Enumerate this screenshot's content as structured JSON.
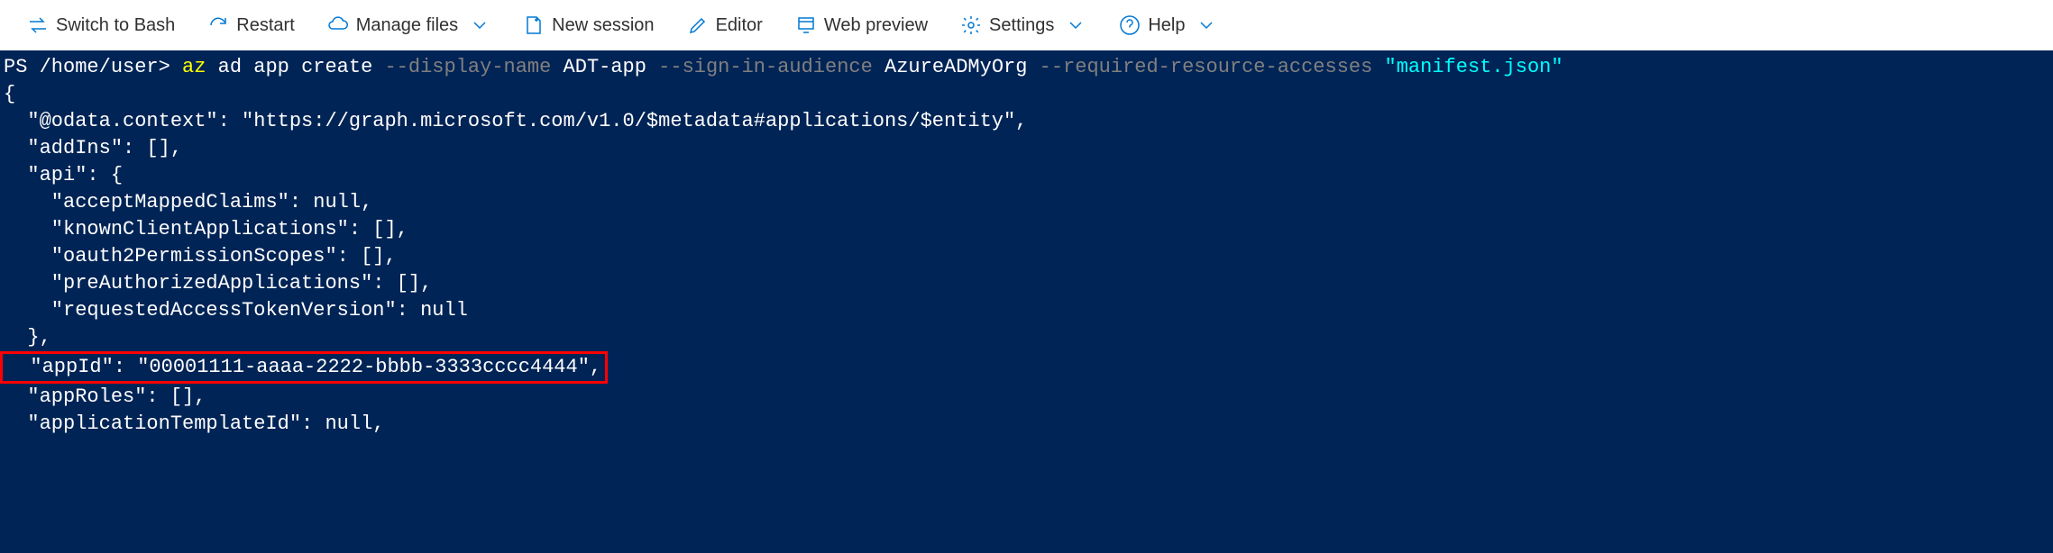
{
  "toolbar": {
    "switch_label": "Switch to Bash",
    "restart_label": "Restart",
    "manage_files_label": "Manage files",
    "new_session_label": "New session",
    "editor_label": "Editor",
    "web_preview_label": "Web preview",
    "settings_label": "Settings",
    "help_label": "Help"
  },
  "terminal": {
    "prompt_prefix": "PS ",
    "prompt_path": "/home/user",
    "prompt_suffix": "> ",
    "cmd_az": "az",
    "cmd_rest": " ad app create ",
    "param_display_name": "--display-name",
    "value_display_name": " ADT-app ",
    "param_signin": "--sign-in-audience",
    "value_signin": " AzureADMyOrg ",
    "param_resources": "--required-resource-accesses",
    "value_manifest": " \"manifest.json\"",
    "output": {
      "line1": "{",
      "line2": "  \"@odata.context\": \"https://graph.microsoft.com/v1.0/$metadata#applications/$entity\",",
      "line3": "  \"addIns\": [],",
      "line4": "  \"api\": {",
      "line5": "    \"acceptMappedClaims\": null,",
      "line6": "    \"knownClientApplications\": [],",
      "line7": "    \"oauth2PermissionScopes\": [],",
      "line8": "    \"preAuthorizedApplications\": [],",
      "line9": "    \"requestedAccessTokenVersion\": null",
      "line10": "  },",
      "line11": "  \"appId\": \"00001111-aaaa-2222-bbbb-3333cccc4444\",",
      "line12": "  \"appRoles\": [],",
      "line13": "  \"applicationTemplateId\": null,"
    }
  }
}
